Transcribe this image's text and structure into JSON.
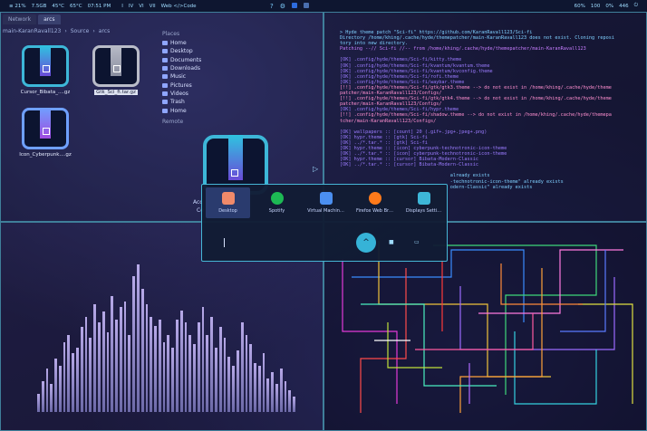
{
  "topbar": {
    "left": [
      "≡ 21%",
      "7.5GB",
      "45°C",
      "65°C",
      "07:51 PM"
    ],
    "workspaces": [
      "I",
      "IV",
      "VI",
      "VII"
    ],
    "window_label": "Web </>Code",
    "center_icons": [
      "?",
      "⚙"
    ],
    "right": [
      "60%",
      "100",
      "0%",
      "446"
    ]
  },
  "file_manager": {
    "tabs": [
      "Network",
      "arcs"
    ],
    "path": [
      "main-KaranRavall123",
      "Source",
      "arcs"
    ],
    "files": [
      {
        "name": "Cursor_Bibata_....gz",
        "style": "cyan"
      },
      {
        "name": "Gtk_Sci_fi.tar.gz",
        "style": "grey",
        "selected": true
      },
      {
        "name": "Icon_Cyberpunk....gz",
        "style": "purple"
      }
    ],
    "places_heading": "Places",
    "places": [
      "Home",
      "Desktop",
      "Documents",
      "Downloads",
      "Music",
      "Pictures",
      "Videos",
      "Trash",
      "Home"
    ],
    "remote_heading": "Remote",
    "cut_off_labels": [
      "Acc",
      "Ce"
    ]
  },
  "terminal": {
    "lines": [
      {
        "t": "> Hyde theme patch \"Sci-fi\" https://github.com/KaranRavall123/Sci-fi",
        "c": "#7fd0ff"
      },
      {
        "t": "Directory /home/khing/.cache/hyde/themepatcher/main-KaranRavall123 does not exist. Cloning reposi",
        "c": "#7fd0ff"
      },
      {
        "t": "tory into new directory.",
        "c": "#7fd0ff"
      },
      {
        "t": "Patching --// Sci-fi //-- from /home/khing/.cache/hyde/themepatcher/main-KaranRavall123",
        "c": "#c77dff"
      },
      {
        "t": "",
        "c": "#7fd0ff"
      },
      {
        "t": "[OK] .config/hyde/themes/Sci-fi/kitty.theme",
        "c": "#9b7bff"
      },
      {
        "t": "[OK] .config/hyde/themes/Sci-fi/kvantum/kvantum.theme",
        "c": "#9b7bff"
      },
      {
        "t": "[OK] .config/hyde/themes/Sci-fi/kvantum/kvconfig.theme",
        "c": "#9b7bff"
      },
      {
        "t": "[OK] .config/hyde/themes/Sci-fi/rofi.theme",
        "c": "#9b7bff"
      },
      {
        "t": "[OK] .config/hyde/themes/Sci-fi/waybar.theme",
        "c": "#9b7bff"
      },
      {
        "t": "[!!] .config/hyde/themes/Sci-fi/gtk/gtk3.theme --> do not exist in /home/khing/.cache/hyde/theme",
        "c": "#ff8fd0"
      },
      {
        "t": "patcher/main-KaranRavall123/Configs/",
        "c": "#ff8fd0"
      },
      {
        "t": "[!!] .config/hyde/themes/Sci-fi/gtk/gtk4.theme --> do not exist in /home/khing/.cache/hyde/theme",
        "c": "#ff8fd0"
      },
      {
        "t": "patcher/main-KaranRavall123/Configs/",
        "c": "#ff8fd0"
      },
      {
        "t": "[OK] .config/hyde/themes/Sci-fi/hypr.theme",
        "c": "#9b7bff"
      },
      {
        "t": "[!!] .config/hyde/themes/Sci-fi/shadow.theme --> do not exist in /home/khing/.cache/hyde/themepa",
        "c": "#ff8fd0"
      },
      {
        "t": "tcher/main-KaranRavall123/Configs/",
        "c": "#ff8fd0"
      },
      {
        "t": "",
        "c": "#7fd0ff"
      },
      {
        "t": "[OK] wallpapers :: [count] 20 (.gif+.jpg+.jpeg+.png)",
        "c": "#9b7bff"
      },
      {
        "t": "[OK] hypr.theme :: [gtk] Sci-fi",
        "c": "#9b7bff"
      },
      {
        "t": "[OK] ../*.tar.* :: [gtk] Sci-fi",
        "c": "#9b7bff"
      },
      {
        "t": "[OK] hypr.theme :: [icon] cyberpunk-technotronic-icon-theme",
        "c": "#9b7bff"
      },
      {
        "t": "[OK] ../*.tar.* :: [icon] cyberpunk-technotronic-icon-theme",
        "c": "#9b7bff"
      },
      {
        "t": "[OK] hypr.theme :: [cursor] Bibata-Modern-Classic",
        "c": "#9b7bff"
      },
      {
        "t": "[OK] ../*.tar.* :: [cursor] Bibata-Modern-Classic",
        "c": "#9b7bff"
      },
      {
        "t": "",
        "c": "#7fd0ff"
      },
      {
        "t": "                                       already exists",
        "c": "#7fd0ff"
      },
      {
        "t": "                                       -technotronic-icon-theme\" already exists",
        "c": "#7fd0ff"
      },
      {
        "t": "                                       odern-Classic\" already exists",
        "c": "#7fd0ff"
      }
    ]
  },
  "launcher": {
    "apps": [
      {
        "label": "Desktop",
        "icon": "desktop-app-icon",
        "color": "#f08a6a",
        "selected": true
      },
      {
        "label": "Spotify",
        "icon": "spotify-icon",
        "color": "#1db954"
      },
      {
        "label": "Virtual Machin…",
        "icon": "vm-icon",
        "color": "#4b8ff0"
      },
      {
        "label": "Firefox Web Br…",
        "icon": "firefox-icon",
        "color": "#ff7a1a"
      },
      {
        "label": "Displays Setti…",
        "icon": "display-settings-icon",
        "color": "#3db7d8"
      }
    ],
    "dock_main": "^"
  },
  "visualizer": {
    "levels": [
      0.12,
      0.2,
      0.28,
      0.18,
      0.35,
      0.3,
      0.45,
      0.5,
      0.38,
      0.42,
      0.55,
      0.62,
      0.48,
      0.7,
      0.58,
      0.65,
      0.52,
      0.75,
      0.6,
      0.68,
      0.72,
      0.5,
      0.88,
      0.96,
      0.8,
      0.7,
      0.62,
      0.56,
      0.6,
      0.45,
      0.5,
      0.42,
      0.6,
      0.66,
      0.58,
      0.5,
      0.44,
      0.58,
      0.68,
      0.5,
      0.62,
      0.42,
      0.55,
      0.48,
      0.36,
      0.3,
      0.4,
      0.58,
      0.5,
      0.44,
      0.32,
      0.3,
      0.38,
      0.22,
      0.26,
      0.18,
      0.28,
      0.2,
      0.14,
      0.1
    ]
  }
}
